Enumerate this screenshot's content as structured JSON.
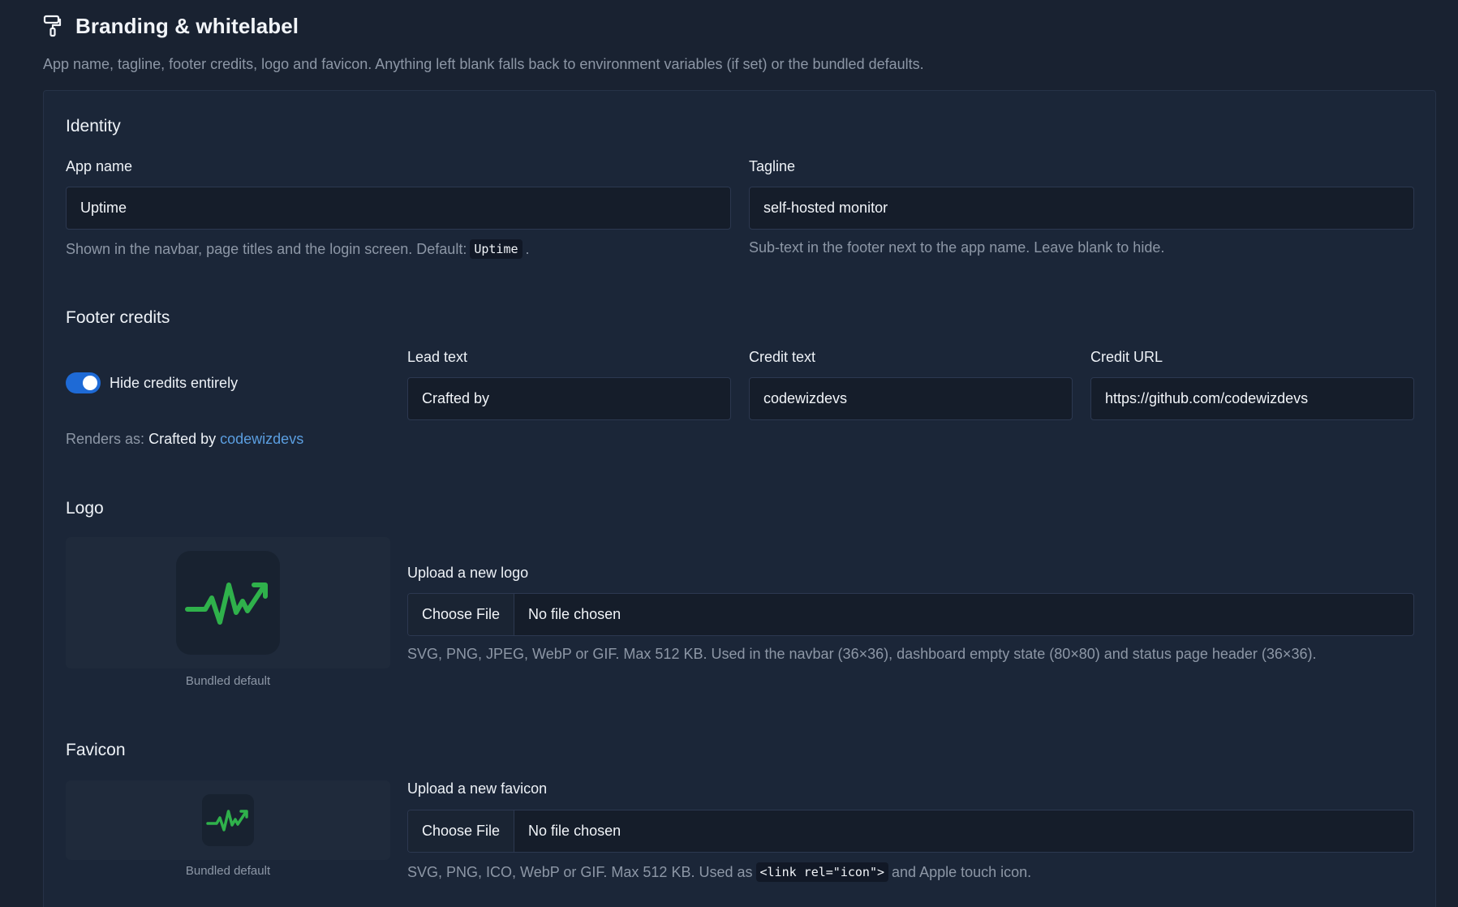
{
  "header": {
    "title": "Branding & whitelabel",
    "icon": "paint-roller-icon",
    "description": "App name, tagline, footer credits, logo and favicon. Anything left blank falls back to environment variables (if set) or the bundled defaults."
  },
  "identity": {
    "section_title": "Identity",
    "app_name": {
      "label": "App name",
      "value": "Uptime",
      "hint_text": "Shown in the navbar, page titles and the login screen. Default:",
      "hint_code": "Uptime",
      "hint_end": "."
    },
    "tagline": {
      "label": "Tagline",
      "value": "self-hosted monitor",
      "hint": "Sub-text in the footer next to the app name. Leave blank to hide."
    }
  },
  "footer_credits": {
    "section_title": "Footer credits",
    "toggle_label": "Hide credits entirely",
    "toggle_on": true,
    "lead_text": {
      "label": "Lead text",
      "value": "Crafted by"
    },
    "credit_text": {
      "label": "Credit text",
      "value": "codewizdevs"
    },
    "credit_url": {
      "label": "Credit URL",
      "value": "https://github.com/codewizdevs"
    },
    "renders_as_prefix": "Renders as:",
    "renders_as_lead": "Crafted by",
    "renders_as_link": "codewizdevs"
  },
  "logo": {
    "section_title": "Logo",
    "preview_caption": "Bundled default",
    "upload_label": "Upload a new logo",
    "choose_button": "Choose File",
    "file_status": "No file chosen",
    "hint": "SVG, PNG, JPEG, WebP or GIF. Max 512 KB. Used in the navbar (36×36), dashboard empty state (80×80) and status page header (36×36)."
  },
  "favicon": {
    "section_title": "Favicon",
    "preview_caption": "Bundled default",
    "upload_label": "Upload a new favicon",
    "choose_button": "Choose File",
    "file_status": "No file chosen",
    "hint_before": "SVG, PNG, ICO, WebP or GIF. Max 512 KB. Used as",
    "hint_code": "<link rel=\"icon\">",
    "hint_after": "and Apple touch icon."
  },
  "colors": {
    "background": "#192231",
    "card": "#1b2638",
    "accent": "#1e6ad6",
    "link": "#5b9ee0",
    "logo_green": "#2fb14b"
  }
}
